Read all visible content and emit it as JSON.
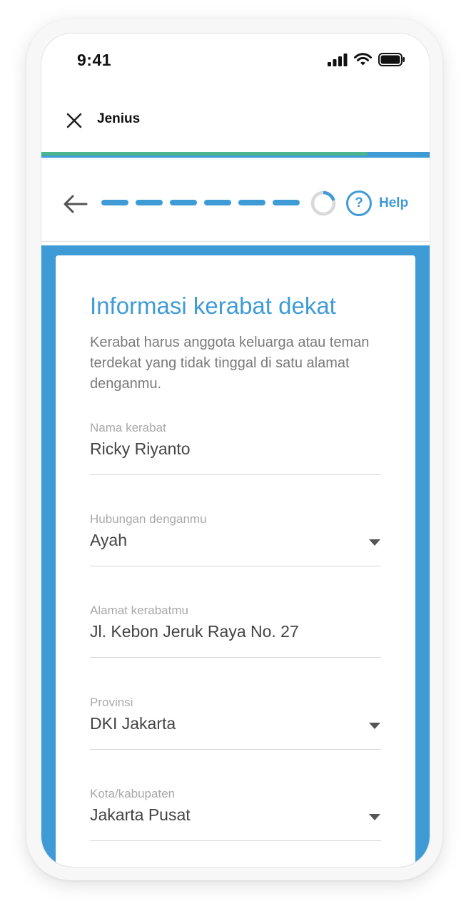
{
  "status_bar": {
    "time": "9:41"
  },
  "browser": {
    "title": "Jenius",
    "progress_percent": 84
  },
  "stepper": {
    "completed_steps": 6,
    "help_label": "Help",
    "help_glyph": "?"
  },
  "form": {
    "title": "Informasi kerabat dekat",
    "description": "Kerabat harus anggota keluarga atau teman terdekat yang tidak tinggal di satu alamat denganmu.",
    "fields": [
      {
        "label": "Nama kerabat",
        "value": "Ricky Riyanto",
        "type": "text"
      },
      {
        "label": "Hubungan denganmu",
        "value": "Ayah",
        "type": "select"
      },
      {
        "label": "Alamat kerabatmu",
        "value": "Jl. Kebon Jeruk Raya No. 27",
        "type": "text"
      },
      {
        "label": "Provinsi",
        "value": "DKI Jakarta",
        "type": "select"
      },
      {
        "label": "Kota/kabupaten",
        "value": "Jakarta Pusat",
        "type": "select"
      }
    ]
  },
  "colors": {
    "primary_blue": "#3f9bd6",
    "progress_green": "#4ab58e",
    "label_gray": "#a9a9a9",
    "text_dark": "#444444"
  },
  "icons": [
    "close-icon",
    "back-arrow-icon",
    "loading-spinner-icon",
    "help-icon",
    "signal-icon",
    "wifi-icon",
    "battery-icon",
    "dropdown-arrow-icon"
  ]
}
